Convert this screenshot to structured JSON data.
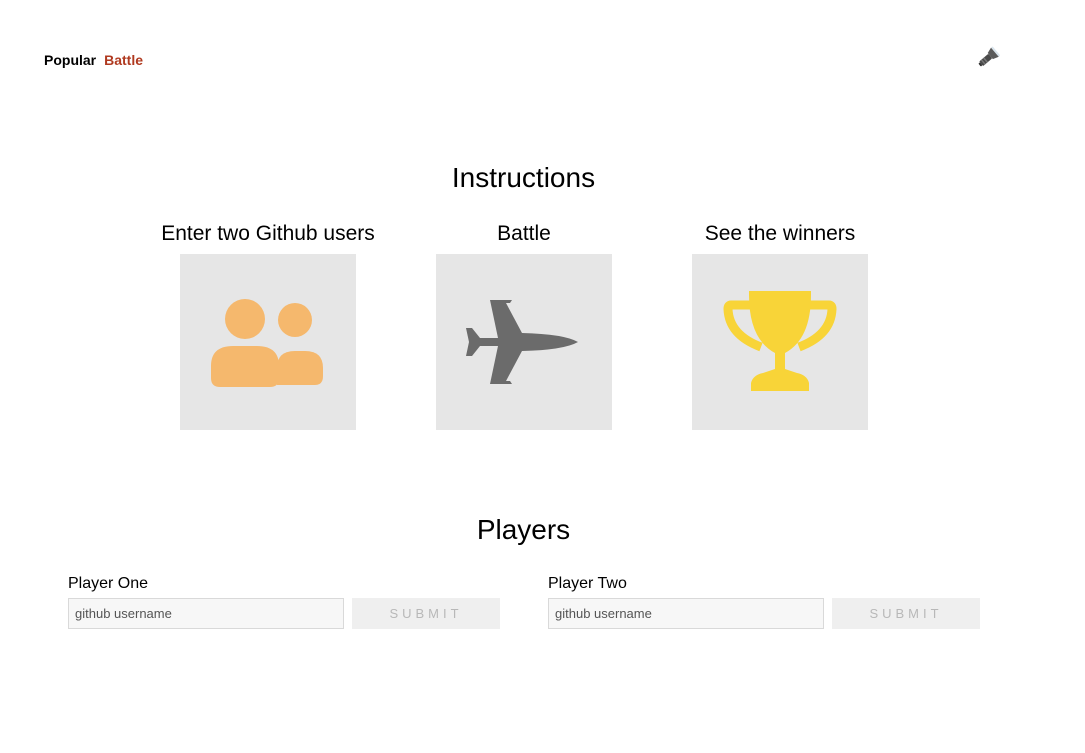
{
  "nav": {
    "items": [
      {
        "label": "Popular"
      },
      {
        "label": "Battle"
      }
    ]
  },
  "theme_toggle": {
    "icon": "flashlight-icon"
  },
  "instructions": {
    "title": "Instructions",
    "steps": [
      {
        "title": "Enter two Github users",
        "icon": "users-icon",
        "color": "#f5b86d"
      },
      {
        "title": "Battle",
        "icon": "fighter-jet-icon",
        "color": "#6b6b6b"
      },
      {
        "title": "See the winners",
        "icon": "trophy-icon",
        "color": "#f8d438"
      }
    ]
  },
  "players": {
    "title": "Players",
    "player_one": {
      "label": "Player One",
      "placeholder": "github username",
      "submit_label": "SUBMIT"
    },
    "player_two": {
      "label": "Player Two",
      "placeholder": "github username",
      "submit_label": "SUBMIT"
    }
  },
  "colors": {
    "active_nav": "#b03a20",
    "icon_box_bg": "#e6e6e6"
  }
}
